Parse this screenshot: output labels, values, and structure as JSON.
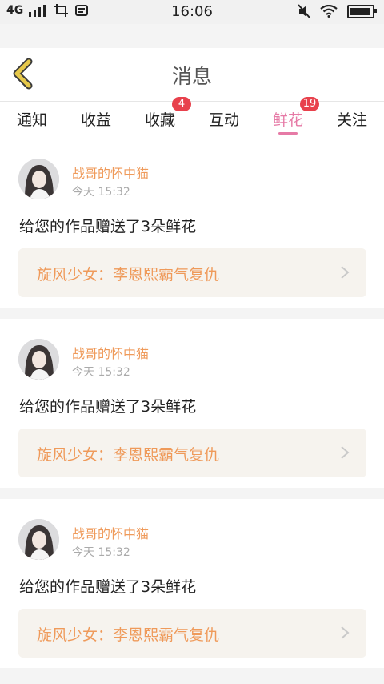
{
  "status_bar": {
    "network": "4G",
    "time": "16:06"
  },
  "header": {
    "title": "消息",
    "back_icon": "back-chevron-icon",
    "accent_color": "#e6c84a"
  },
  "tabs": [
    {
      "label": "通知",
      "badge": null,
      "active": false
    },
    {
      "label": "收益",
      "badge": null,
      "active": false
    },
    {
      "label": "收藏",
      "badge": "4",
      "active": false
    },
    {
      "label": "互动",
      "badge": null,
      "active": false
    },
    {
      "label": "鲜花",
      "badge": "19",
      "active": true
    },
    {
      "label": "关注",
      "badge": null,
      "active": false
    }
  ],
  "messages": [
    {
      "sender": "战哥的怀中猫",
      "time": "今天 15:32",
      "text": "给您的作品赠送了3朵鲜花",
      "work": "旋风少女：李恩熙霸气复仇"
    },
    {
      "sender": "战哥的怀中猫",
      "time": "今天 15:32",
      "text": "给您的作品赠送了3朵鲜花",
      "work": "旋风少女：李恩熙霸气复仇"
    },
    {
      "sender": "战哥的怀中猫",
      "time": "今天 15:32",
      "text": "给您的作品赠送了3朵鲜花",
      "work": "旋风少女：李恩熙霸气复仇"
    }
  ],
  "colors": {
    "active_tab": "#e67aa6",
    "badge": "#e8414c",
    "sender": "#ef9a5a",
    "link_bg": "#f6f3ee"
  }
}
